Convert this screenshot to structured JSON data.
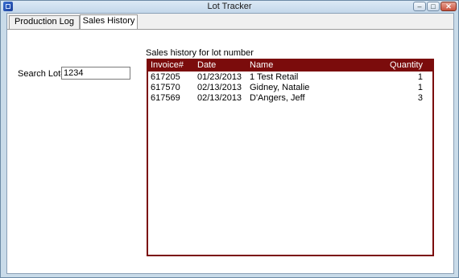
{
  "window": {
    "title": "Lot Tracker",
    "minimize_glyph": "–",
    "maximize_glyph": "□",
    "close_glyph": "✕"
  },
  "tabs": [
    {
      "label": "Production Log",
      "selected": false
    },
    {
      "label": "Sales History",
      "selected": true
    }
  ],
  "search": {
    "label": "Search Lot#",
    "value": "1234"
  },
  "sales_history": {
    "caption": "Sales history for lot number",
    "columns": [
      "Invoice#",
      "Date",
      "Name",
      "Quantity"
    ],
    "rows": [
      {
        "invoice": "617205",
        "date": "01/23/2013",
        "name": "1 Test Retail",
        "quantity": "1"
      },
      {
        "invoice": "617570",
        "date": "02/13/2013",
        "name": "Gidney, Natalie",
        "quantity": "1"
      },
      {
        "invoice": "617569",
        "date": "02/13/2013",
        "name": "D'Angers, Jeff",
        "quantity": "3"
      }
    ]
  },
  "colors": {
    "grid_header": "#7b0c0c",
    "window_frame": "#c9dbe9"
  }
}
